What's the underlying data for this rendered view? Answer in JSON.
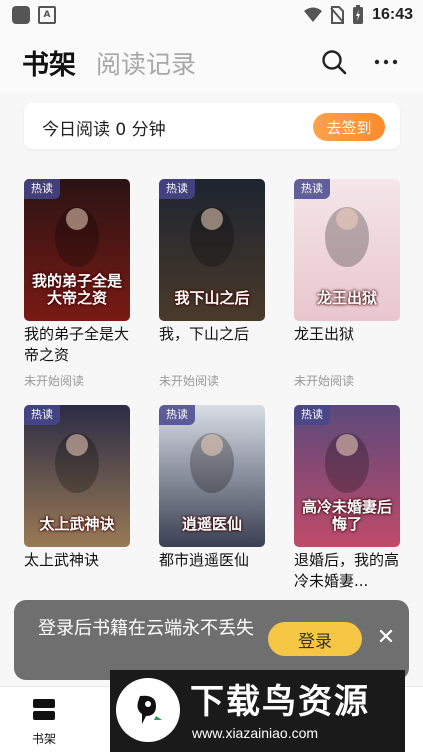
{
  "status_bar": {
    "time": "16:43"
  },
  "header": {
    "tab_active": "书架",
    "tab_inactive": "阅读记录"
  },
  "reading_card": {
    "text": "今日阅读 0 分钟",
    "checkin_label": "去签到"
  },
  "books": [
    {
      "badge": "热读",
      "title": "我的弟子全是大帝之资",
      "status": "未开始阅读",
      "cover_text": "我的弟子全是大帝之资",
      "colors": [
        "#2a1414",
        "#7a1a14"
      ]
    },
    {
      "badge": "热读",
      "title": "我，下山之后",
      "status": "未开始阅读",
      "cover_text": "我下山之后",
      "colors": [
        "#1d2530",
        "#4a3a2a"
      ]
    },
    {
      "badge": "热读",
      "title": "龙王出狱",
      "status": "未开始阅读",
      "cover_text": "龙王出狱",
      "colors": [
        "#f4e6ea",
        "#e9c6cf"
      ]
    },
    {
      "badge": "热读",
      "title": "太上武神诀",
      "status": "",
      "cover_text": "太上武神诀",
      "colors": [
        "#2a2c45",
        "#9a7a55"
      ]
    },
    {
      "badge": "热读",
      "title": "都市逍遥医仙",
      "status": "",
      "cover_text": "逍遥医仙",
      "colors": [
        "#d9dde6",
        "#3a3f52"
      ]
    },
    {
      "badge": "热读",
      "title": "退婚后，我的高冷未婚妻...",
      "status": "",
      "cover_text": "高冷未婚妻后悔了",
      "colors": [
        "#5a4a7a",
        "#c04a6a"
      ]
    }
  ],
  "login_toast": {
    "text": "登录后书籍在云端永不丢失",
    "button": "登录"
  },
  "bottom_nav": {
    "shelf_label": "书架"
  },
  "watermark": {
    "title": "下载鸟资源",
    "url": "www.xiazainiao.com"
  }
}
